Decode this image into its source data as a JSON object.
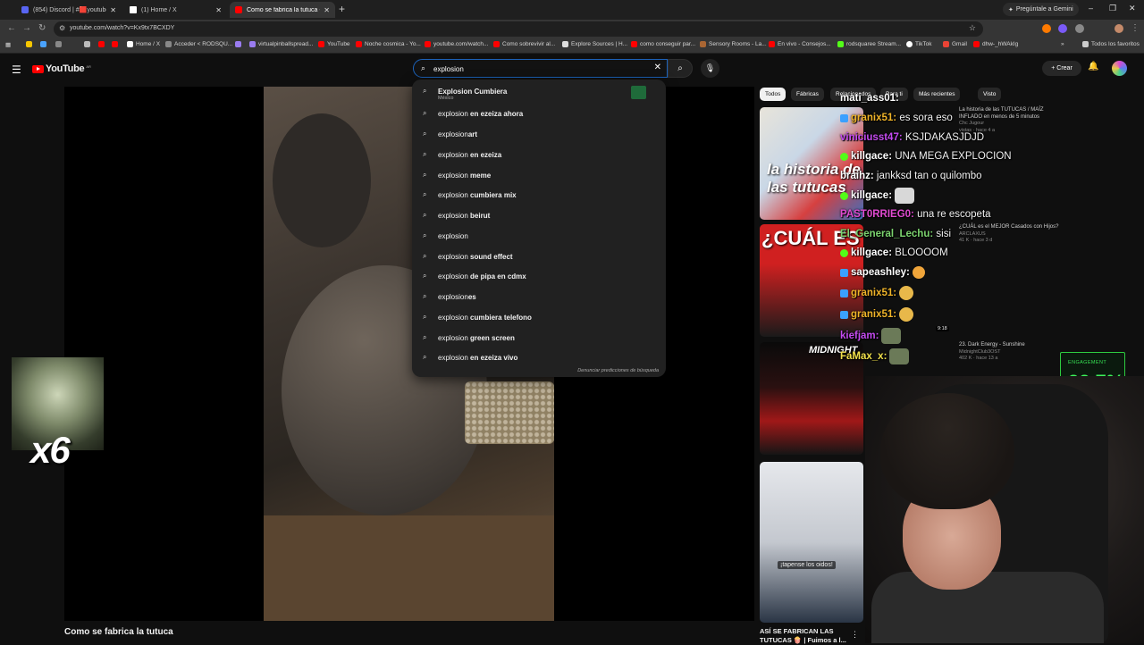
{
  "browser": {
    "tabs": [
      {
        "label": "(854) Discord | #🟥youtube | li",
        "color": "#5865f2"
      },
      {
        "label": "(1) Home / X",
        "color": "#ffffff"
      },
      {
        "label": "Como se fabrica la tutuca - Yo",
        "color": "#ff0000"
      }
    ],
    "gemini_label": "Pregúntale a Gemini",
    "url": "youtube.com/watch?v=Kx9tx7BCXDY",
    "bookmarks": [
      {
        "label": "Home / X",
        "color": "#ffffff"
      },
      {
        "label": "Acceder < RODSQU...",
        "color": "#888888"
      },
      {
        "label": "virtualpinballspread...",
        "color": "#9a7cf0"
      },
      {
        "label": "YouTube",
        "color": "#ff0000"
      },
      {
        "label": "Noche cosmica - Yo...",
        "color": "#ff0000"
      },
      {
        "label": "youtube.com/watch...",
        "color": "#ff0000"
      },
      {
        "label": "Como sobrevivir al...",
        "color": "#ff0000"
      },
      {
        "label": "Explore Sources | H...",
        "color": "#dddddd"
      },
      {
        "label": "como conseguir par...",
        "color": "#ff0000"
      },
      {
        "label": "Sensory Rooms - La...",
        "color": "#aa6633"
      },
      {
        "label": "En vivo - Consejos...",
        "color": "#ff0000"
      },
      {
        "label": "rodsquaree Stream...",
        "color": "#53fc18"
      },
      {
        "label": "TikTok",
        "color": "#ffffff"
      },
      {
        "label": "Gmail",
        "color": "#ea4335"
      },
      {
        "label": "dhw-_hWAkIg",
        "color": "#ff0000"
      }
    ],
    "all_bookmarks": "Todos los favoritos"
  },
  "youtube": {
    "logo_word": "YouTube",
    "logo_country": "AR",
    "search_value": "explosion",
    "create_label": "Crear",
    "suggestions": [
      {
        "base": "Explosion",
        "rest": " Cumbiera",
        "sub": "México"
      },
      {
        "base": "explosion",
        "rest": " en ezeiza ahora"
      },
      {
        "base": "explosion",
        "rest": "art"
      },
      {
        "base": "explosion",
        "rest": " en ezeiza"
      },
      {
        "base": "explosion",
        "rest": " meme"
      },
      {
        "base": "explosion",
        "rest": " cumbiera mix"
      },
      {
        "base": "explosion",
        "rest": " beirut"
      },
      {
        "base": "explosion",
        "rest": ""
      },
      {
        "base": "explosion",
        "rest": " sound effect"
      },
      {
        "base": "explosion",
        "rest": " de pipa en cdmx"
      },
      {
        "base": "explosion",
        "rest": "es"
      },
      {
        "base": "explosion",
        "rest": " cumbiera telefono"
      },
      {
        "base": "explosion",
        "rest": " green screen"
      },
      {
        "base": "explosion",
        "rest": " en ezeiza vivo"
      }
    ],
    "report_label": "Denunciar predicciones de búsqueda",
    "video_title": "Como se fabrica la tutuca",
    "chips": [
      "Todos",
      "Fábricas",
      "Relacionados",
      "Para ti",
      "Más recientes",
      "Visto"
    ],
    "recommended": [
      {
        "thumb_text": "la historia de las tutucas",
        "title": "La historia de las TUTUCAS / MAÍZ INFLADO en menos de 5 minutos",
        "channel": "Chc Jugour",
        "meta": "vistas · hace 4 a"
      },
      {
        "thumb_text": "¿CUÁL ES",
        "title": "¿CUÁL es el MEJOR Casados con Hijos?",
        "channel": "ARCLAXUS",
        "meta": "41 K · hace 3 d",
        "duration": "9:18"
      },
      {
        "thumb_text": "MIDNIGHT",
        "title": "23. Dark Energy - Sunshine",
        "channel": "MidnightClub3OST",
        "meta": "402 K · hace 13 a"
      },
      {
        "caption": "¡tapense los oidos!",
        "title": "ASÍ SE FABRICAN LAS TUTUCAS 🍿 | Fuimos a l..."
      }
    ]
  },
  "stream": {
    "emote_multiplier": "x6",
    "engagement_label": "ENGAGEMENT",
    "engagement_value": "22.7%",
    "chat": [
      {
        "name": "mati_ass01:",
        "msg": "",
        "color": "#ffffff",
        "badge": ""
      },
      {
        "name": "granix51:",
        "msg": "es sora eso",
        "color": "#f0b429",
        "badge": "#3aa0ff"
      },
      {
        "name": "viniciusst47:",
        "msg": "KSJDAKASJDJD",
        "color": "#c44bf0",
        "badge": ""
      },
      {
        "name": "killgace:",
        "msg": "UNA MEGA EXPLOCION",
        "color": "#ffffff",
        "badge": "#53fc18"
      },
      {
        "name": "braihz:",
        "msg": "jankksd tan o quilombo",
        "color": "#ffffff",
        "badge": ""
      },
      {
        "name": "killgace:",
        "msg": "",
        "color": "#ffffff",
        "badge": "#53fc18"
      },
      {
        "name": "PAST0RRIEG0:",
        "msg": "una re escopeta",
        "color": "#e04bd0",
        "badge": ""
      },
      {
        "name": "El_General_Lechu:",
        "msg": "sisi",
        "color": "#7bd26e",
        "badge": ""
      },
      {
        "name": "killgace:",
        "msg": "BLOOOOM",
        "color": "#ffffff",
        "badge": "#53fc18"
      },
      {
        "name": "sapeashley:",
        "msg": "",
        "color": "#ffffff",
        "badge": "#3aa0ff"
      },
      {
        "name": "granix51:",
        "msg": "",
        "color": "#f0b429",
        "badge": "#3aa0ff"
      },
      {
        "name": "granix51:",
        "msg": "",
        "color": "#f0b429",
        "badge": "#3aa0ff"
      },
      {
        "name": "kiefjam:",
        "msg": "",
        "color": "#c44bf0",
        "badge": ""
      },
      {
        "name": "FaMax_x:",
        "msg": "",
        "color": "#f0e04b",
        "badge": ""
      }
    ]
  }
}
